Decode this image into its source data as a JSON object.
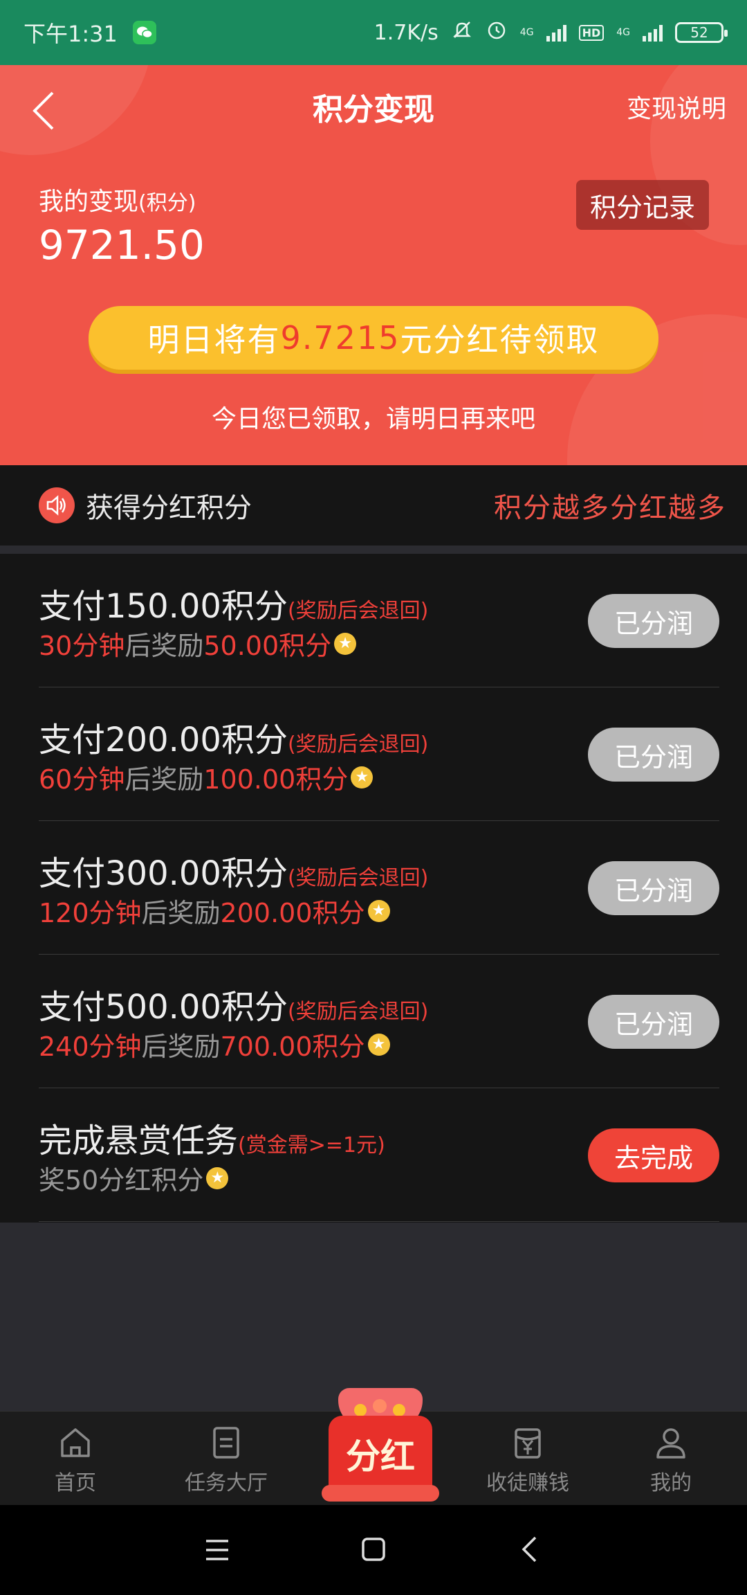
{
  "status_bar": {
    "time": "下午1:31",
    "net_speed": "1.7K/s",
    "net_label": "4G",
    "hd_label": "HD",
    "battery": "52"
  },
  "header": {
    "title": "积分变现",
    "explain_link": "变现说明",
    "my_label": "我的变现",
    "my_label_unit": "(积分)",
    "my_value": "9721.50",
    "record_button": "积分记录",
    "dividend_prefix": "明日将有",
    "dividend_amount": "9.7215",
    "dividend_suffix": "元分红待领取",
    "claimed_note": "今日您已领取，请明日再来吧"
  },
  "section": {
    "label": "获得分红积分",
    "slogan": "积分越多分红越多"
  },
  "tasks": [
    {
      "title": "支付150.00积分",
      "note": "(奖励后会退回)",
      "time": "30分钟",
      "mid": "后奖励",
      "reward": "50.00积分",
      "button": "已分润"
    },
    {
      "title": "支付200.00积分",
      "note": "(奖励后会退回)",
      "time": "60分钟",
      "mid": "后奖励",
      "reward": "100.00积分",
      "button": "已分润"
    },
    {
      "title": "支付300.00积分",
      "note": "(奖励后会退回)",
      "time": "120分钟",
      "mid": "后奖励",
      "reward": "200.00积分",
      "button": "已分润"
    },
    {
      "title": "支付500.00积分",
      "note": "(奖励后会退回)",
      "time": "240分钟",
      "mid": "后奖励",
      "reward": "700.00积分",
      "button": "已分润"
    },
    {
      "title": "完成悬赏任务",
      "note": "(赏金需>=1元)",
      "sub": "奖50分红积分",
      "button": "去完成"
    }
  ],
  "bottom_nav": {
    "home": "首页",
    "tasks": "任务大厅",
    "center": "分红",
    "invite": "收徒赚钱",
    "mine": "我的"
  },
  "colors": {
    "status_bar": "#1a8a5e",
    "header_red": "#f05448",
    "pill_yellow": "#fbc02d",
    "accent_red": "#f0403a"
  }
}
